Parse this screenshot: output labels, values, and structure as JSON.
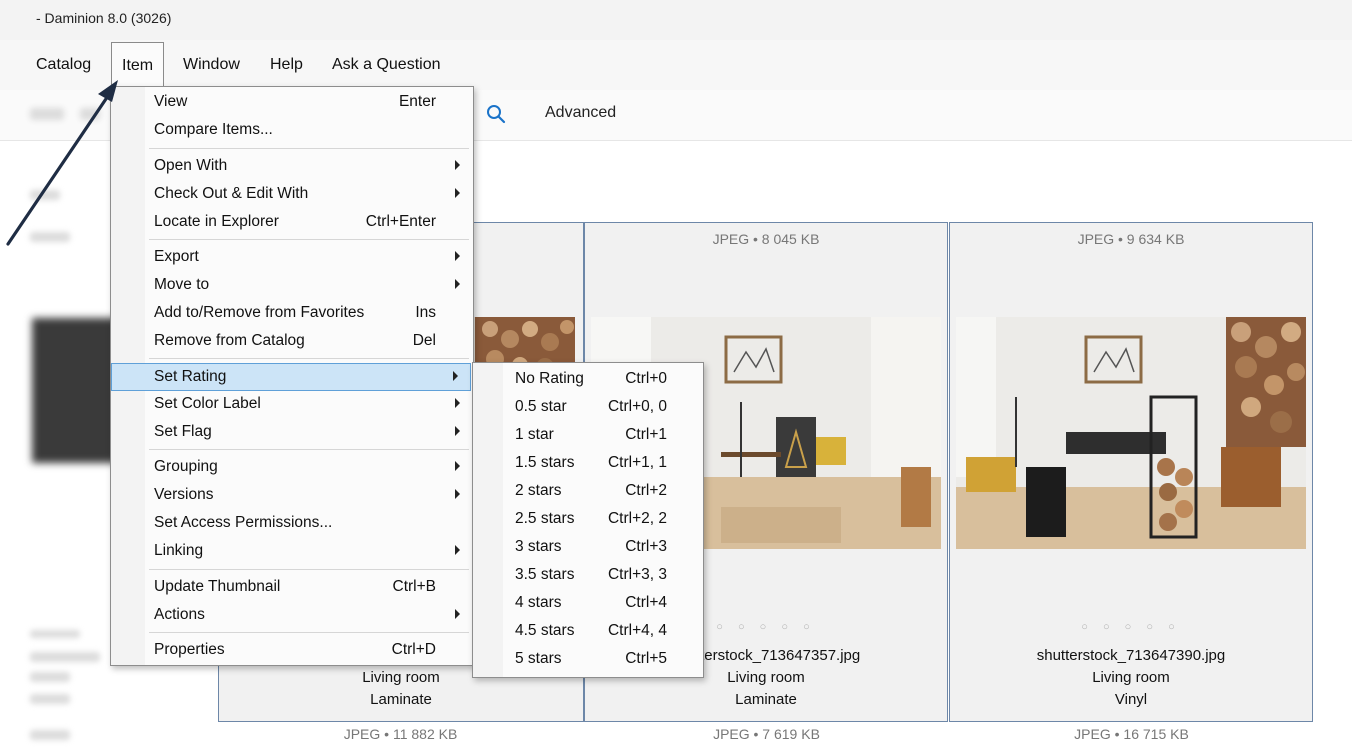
{
  "window": {
    "title": "- Daminion 8.0 (3026)"
  },
  "menubar": {
    "items": [
      {
        "label": "Catalog"
      },
      {
        "label": "Item"
      },
      {
        "label": "Window"
      },
      {
        "label": "Help"
      },
      {
        "label": "Ask a Question"
      }
    ],
    "open_item": "Item"
  },
  "toolbar": {
    "advanced_label": "Advanced",
    "search_icon": "search-icon"
  },
  "item_menu": {
    "items": [
      {
        "label": "View",
        "shortcut": "Enter"
      },
      {
        "label": "Compare Items...",
        "shortcut": ""
      },
      {
        "label": "Open With",
        "shortcut": "",
        "submenu": true
      },
      {
        "label": "Check Out & Edit With",
        "shortcut": "",
        "submenu": true
      },
      {
        "label": "Locate in Explorer",
        "shortcut": "Ctrl+Enter"
      },
      {
        "label": "Export",
        "shortcut": "",
        "submenu": true
      },
      {
        "label": "Move to",
        "shortcut": "",
        "submenu": true
      },
      {
        "label": "Add to/Remove from Favorites",
        "shortcut": "Ins"
      },
      {
        "label": "Remove from Catalog",
        "shortcut": "Del"
      },
      {
        "label": "Set Rating",
        "shortcut": "",
        "submenu": true,
        "highlighted": true
      },
      {
        "label": "Set Color Label",
        "shortcut": "",
        "submenu": true
      },
      {
        "label": "Set Flag",
        "shortcut": "",
        "submenu": true
      },
      {
        "label": "Grouping",
        "shortcut": "",
        "submenu": true
      },
      {
        "label": "Versions",
        "shortcut": "",
        "submenu": true
      },
      {
        "label": "Set Access Permissions...",
        "shortcut": ""
      },
      {
        "label": "Linking",
        "shortcut": "",
        "submenu": true
      },
      {
        "label": "Update Thumbnail",
        "shortcut": "Ctrl+B"
      },
      {
        "label": "Actions",
        "shortcut": "",
        "submenu": true
      },
      {
        "label": "Properties",
        "shortcut": "Ctrl+D"
      }
    ]
  },
  "rating_submenu": {
    "items": [
      {
        "label": "No Rating",
        "shortcut": "Ctrl+0"
      },
      {
        "label": "0.5 star",
        "shortcut": "Ctrl+0, 0"
      },
      {
        "label": "1 star",
        "shortcut": "Ctrl+1"
      },
      {
        "label": "1.5 stars",
        "shortcut": "Ctrl+1, 1"
      },
      {
        "label": "2 stars",
        "shortcut": "Ctrl+2"
      },
      {
        "label": "2.5 stars",
        "shortcut": "Ctrl+2, 2"
      },
      {
        "label": "3 stars",
        "shortcut": "Ctrl+3"
      },
      {
        "label": "3.5 stars",
        "shortcut": "Ctrl+3, 3"
      },
      {
        "label": "4 stars",
        "shortcut": "Ctrl+4"
      },
      {
        "label": "4.5 stars",
        "shortcut": "Ctrl+4, 4"
      },
      {
        "label": "5 stars",
        "shortcut": "Ctrl+5"
      }
    ]
  },
  "cards": [
    {
      "meta": "",
      "filename": "",
      "room": "Living room",
      "floor": "Laminate"
    },
    {
      "meta": "JPEG • 8 045 KB",
      "filename": "shutterstock_713647357.jpg",
      "room": "Living room",
      "floor": "Laminate"
    },
    {
      "meta": "JPEG • 9 634 KB",
      "filename": "shutterstock_713647390.jpg",
      "room": "Living room",
      "floor": "Vinyl"
    }
  ],
  "next_row_meta": [
    "JPEG • 11 882 KB",
    "JPEG • 7 619 KB",
    "JPEG • 16 715 KB"
  ],
  "rating_dots": "○ ○ ○ ○ ○",
  "colors": {
    "highlight": "#cce4f7",
    "highlight_border": "#5fa0d8",
    "card_border": "#6d87a8",
    "arrow": "#1f2d44"
  }
}
